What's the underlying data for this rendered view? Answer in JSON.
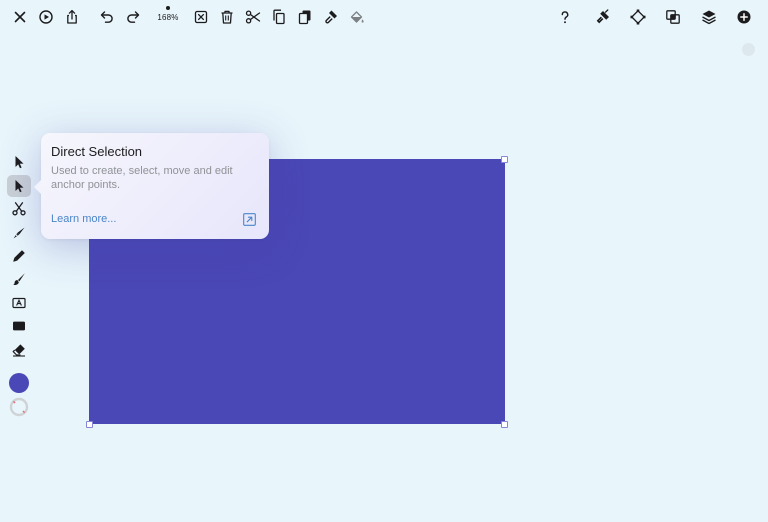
{
  "toolbar": {
    "left_icons": [
      "close-icon",
      "play-circle-icon",
      "share-icon",
      "undo-icon",
      "redo-icon"
    ],
    "zoom": "168%",
    "middle_icons": [
      "deselect-icon",
      "trash-icon",
      "scissors-icon",
      "copy-icon",
      "duplicate-icon",
      "format-brush-icon",
      "fill-bucket-icon"
    ],
    "right_icons": [
      "help-icon",
      "tools-icon",
      "vector-icon",
      "boolean-icon",
      "layers-icon",
      "add-icon"
    ]
  },
  "tools": [
    "selection-tool",
    "direct-selection-tool",
    "scissors-tool",
    "pen-tool",
    "pencil-tool",
    "brush-tool",
    "text-tool",
    "shape-tool",
    "eraser-tool"
  ],
  "active_tool": "direct-selection-tool",
  "colors": {
    "fill": "#4a47b6",
    "background": "#e8f5fb",
    "link": "#4a86c9"
  },
  "tooltip": {
    "title": "Direct Selection",
    "description": "Used to create, select, move and edit anchor points.",
    "link_label": "Learn more..."
  }
}
